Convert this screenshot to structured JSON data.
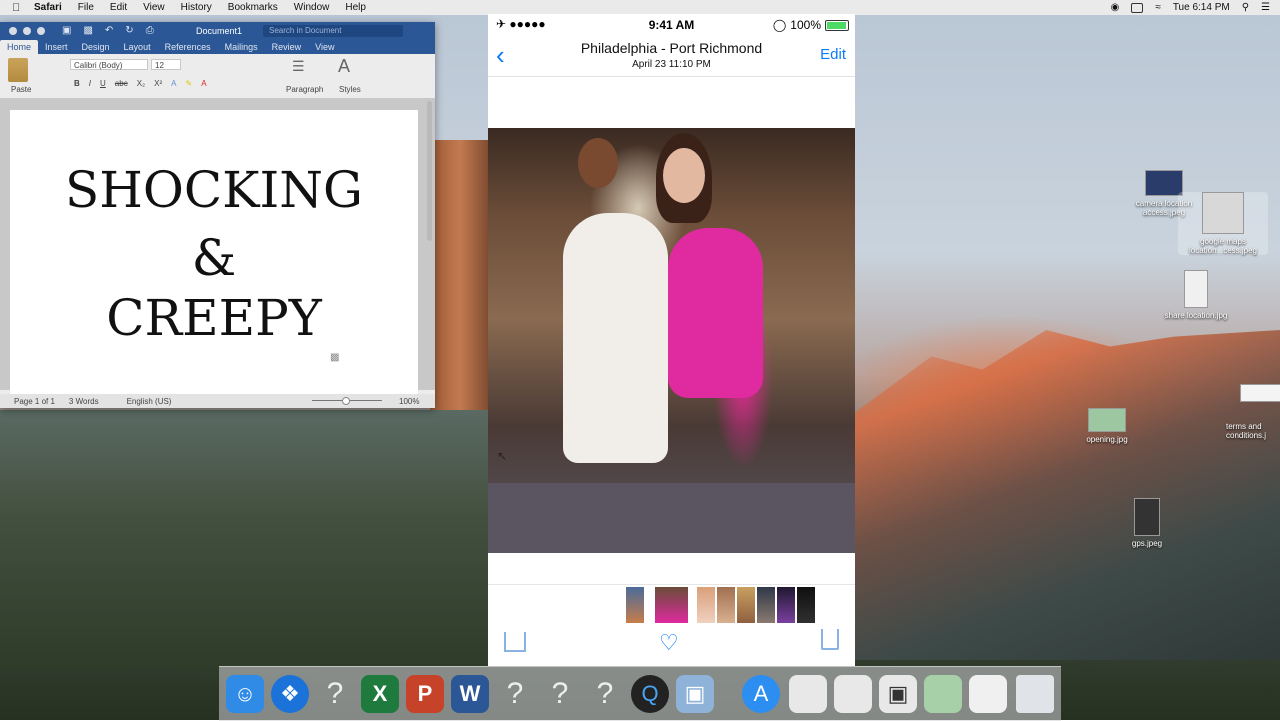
{
  "menubar": {
    "app": "Safari",
    "items": [
      "File",
      "Edit",
      "View",
      "History",
      "Bookmarks",
      "Window",
      "Help"
    ],
    "clock": "Tue 6:14 PM"
  },
  "word": {
    "title": "Document1",
    "search_placeholder": "Search in Document",
    "tabs": [
      "Home",
      "Insert",
      "Design",
      "Layout",
      "References",
      "Mailings",
      "Review",
      "View"
    ],
    "active_tab": "Home",
    "ribbon": {
      "paste": "Paste",
      "font": "Calibri (Body)",
      "size": "12",
      "bold": "B",
      "italic": "I",
      "underline": "U",
      "strike": "abc",
      "subscript": "X₂",
      "superscript": "X²",
      "paragraph": "Paragraph",
      "styles": "Styles"
    },
    "doc_lines": [
      "SHOCKING",
      "&",
      "CREEPY"
    ],
    "status": {
      "page": "Page 1 of 1",
      "words": "3 Words",
      "language": "English (US)",
      "zoom": "100%"
    }
  },
  "phone": {
    "time": "9:41 AM",
    "battery": "100%",
    "title": "Philadelphia - Port Richmond",
    "subtitle": "April 23  11:10 PM",
    "edit": "Edit"
  },
  "desktop_icons": [
    {
      "label": "camera location access.jpeg"
    },
    {
      "label": "google maps location...cess.jpeg"
    },
    {
      "label": "share location.jpg"
    },
    {
      "label": "terms and conditions.j"
    },
    {
      "label": "opening.jpg"
    },
    {
      "label": "gps.jpeg"
    }
  ],
  "icons": [
    "apple-icon",
    "wifi-icon",
    "search-icon",
    "airplane-icon",
    "heart-icon",
    "share-icon",
    "trash-icon",
    "back-chevron-icon"
  ],
  "colors": {
    "ios_blue": "#0a7cf8",
    "word_blue": "#2b5796",
    "battery_green": "#4cd964"
  }
}
